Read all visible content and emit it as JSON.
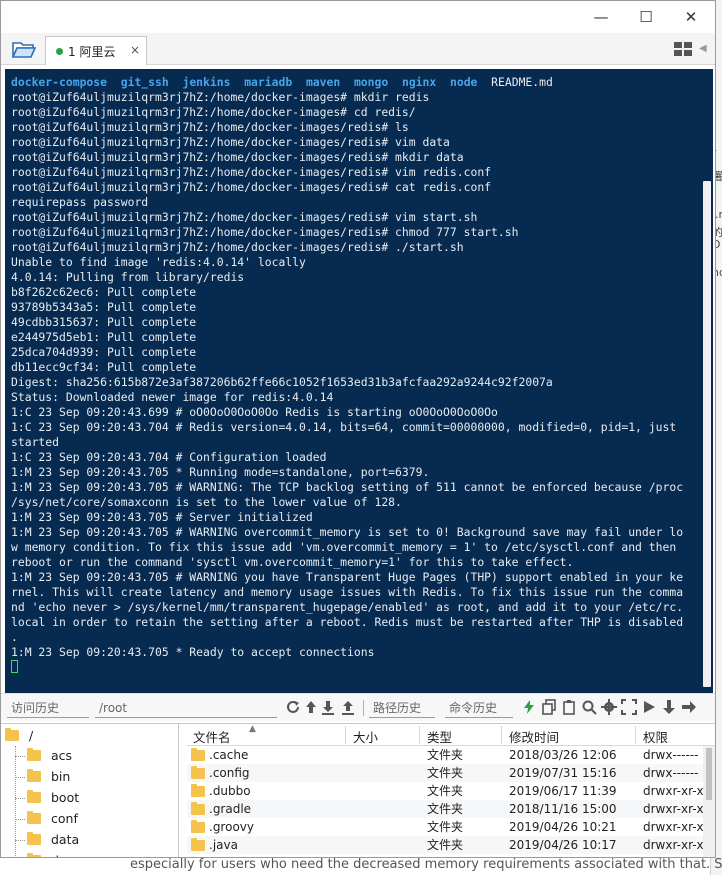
{
  "window": {
    "controls": {
      "minimize": "—",
      "maximize": "☐",
      "close": "✕"
    }
  },
  "tabs": [
    {
      "number": "1",
      "label": "1 阿里云",
      "close": "×"
    }
  ],
  "terminal": {
    "dir_listing": [
      "docker-compose",
      "git_ssh",
      "jenkins",
      "mariadb",
      "maven",
      "mongo",
      "nginx",
      "node"
    ],
    "dir_listing_file": "README.md",
    "lines": [
      "root@iZuf64uljmuzilqrm3rj7hZ:/home/docker-images# mkdir redis",
      "root@iZuf64uljmuzilqrm3rj7hZ:/home/docker-images# cd redis/",
      "root@iZuf64uljmuzilqrm3rj7hZ:/home/docker-images/redis# ls",
      "root@iZuf64uljmuzilqrm3rj7hZ:/home/docker-images/redis# vim data",
      "root@iZuf64uljmuzilqrm3rj7hZ:/home/docker-images/redis# mkdir data",
      "root@iZuf64uljmuzilqrm3rj7hZ:/home/docker-images/redis# vim redis.conf",
      "root@iZuf64uljmuzilqrm3rj7hZ:/home/docker-images/redis# cat redis.conf",
      "requirepass password",
      "root@iZuf64uljmuzilqrm3rj7hZ:/home/docker-images/redis# vim start.sh",
      "root@iZuf64uljmuzilqrm3rj7hZ:/home/docker-images/redis# chmod 777 start.sh",
      "root@iZuf64uljmuzilqrm3rj7hZ:/home/docker-images/redis# ./start.sh",
      "Unable to find image 'redis:4.0.14' locally",
      "4.0.14: Pulling from library/redis",
      "b8f262c62ec6: Pull complete",
      "93789b5343a5: Pull complete",
      "49cdbb315637: Pull complete",
      "e244975d5eb1: Pull complete",
      "25dca704d939: Pull complete",
      "db11ecc9cf34: Pull complete",
      "Digest: sha256:615b872e3af387206b62ffe66c1052f1653ed31b3afcfaa292a9244c92f2007a",
      "Status: Downloaded newer image for redis:4.0.14",
      "1:C 23 Sep 09:20:43.699 # oO0OoO0OoO0Oo Redis is starting oO0OoO0OoO0Oo",
      "1:C 23 Sep 09:20:43.704 # Redis version=4.0.14, bits=64, commit=00000000, modified=0, pid=1, just",
      "started",
      "1:C 23 Sep 09:20:43.704 # Configuration loaded",
      "1:M 23 Sep 09:20:43.705 * Running mode=standalone, port=6379.",
      "1:M 23 Sep 09:20:43.705 # WARNING: The TCP backlog setting of 511 cannot be enforced because /proc",
      "/sys/net/core/somaxconn is set to the lower value of 128.",
      "1:M 23 Sep 09:20:43.705 # Server initialized",
      "1:M 23 Sep 09:20:43.705 # WARNING overcommit_memory is set to 0! Background save may fail under lo",
      "w memory condition. To fix this issue add 'vm.overcommit_memory = 1' to /etc/sysctl.conf and then",
      "reboot or run the command 'sysctl vm.overcommit_memory=1' for this to take effect.",
      "1:M 23 Sep 09:20:43.705 # WARNING you have Transparent Huge Pages (THP) support enabled in your ke",
      "rnel. This will create latency and memory usage issues with Redis. To fix this issue run the comma",
      "nd 'echo never > /sys/kernel/mm/transparent_hugepage/enabled' as root, and add it to your /etc/rc.",
      "local in order to retain the setting after a reboot. Redis must be restarted after THP is disabled",
      ".",
      "1:M 23 Sep 09:20:43.705 * Ready to accept connections"
    ]
  },
  "command_bar": {
    "history_placeholder": "访问历史",
    "current_path": "/root",
    "path_history": "路径历史",
    "command_history": "命令历史"
  },
  "tree": {
    "root": "/",
    "items": [
      "acs",
      "bin",
      "boot",
      "conf",
      "data",
      "dev"
    ]
  },
  "file_table": {
    "headers": [
      "文件名",
      "大小",
      "类型",
      "修改时间",
      "权限"
    ],
    "sort_indicator": "▲",
    "rows": [
      {
        "name": ".cache",
        "size": "",
        "type": "文件夹",
        "modified": "2018/03/26 12:06",
        "perms": "drwx------"
      },
      {
        "name": ".config",
        "size": "",
        "type": "文件夹",
        "modified": "2019/07/31 15:16",
        "perms": "drwx------"
      },
      {
        "name": ".dubbo",
        "size": "",
        "type": "文件夹",
        "modified": "2019/06/17 11:39",
        "perms": "drwxr-xr-x"
      },
      {
        "name": ".gradle",
        "size": "",
        "type": "文件夹",
        "modified": "2018/11/16 15:00",
        "perms": "drwxr-xr-x"
      },
      {
        "name": ".groovy",
        "size": "",
        "type": "文件夹",
        "modified": "2019/04/26 10:21",
        "perms": "drwxr-xr-x"
      },
      {
        "name": ".java",
        "size": "",
        "type": "文件夹",
        "modified": "2019/04/26 10:17",
        "perms": "drwxr-xr-x"
      }
    ]
  },
  "background_page": {
    "footer_text": "especially for users who need the decreased memory requirements associated with that. S",
    "side_fragments": [
      "r",
      "署",
      "l.r",
      "的",
      "D",
      "nd"
    ]
  },
  "colors": {
    "terminal_bg": "#062a50",
    "terminal_fg": "#e6ecf2",
    "dir_color": "#49a5ea",
    "cursor_color": "#3ddc5a",
    "folder_color": "#f3c34e",
    "tab_dot": "#2ea043"
  }
}
